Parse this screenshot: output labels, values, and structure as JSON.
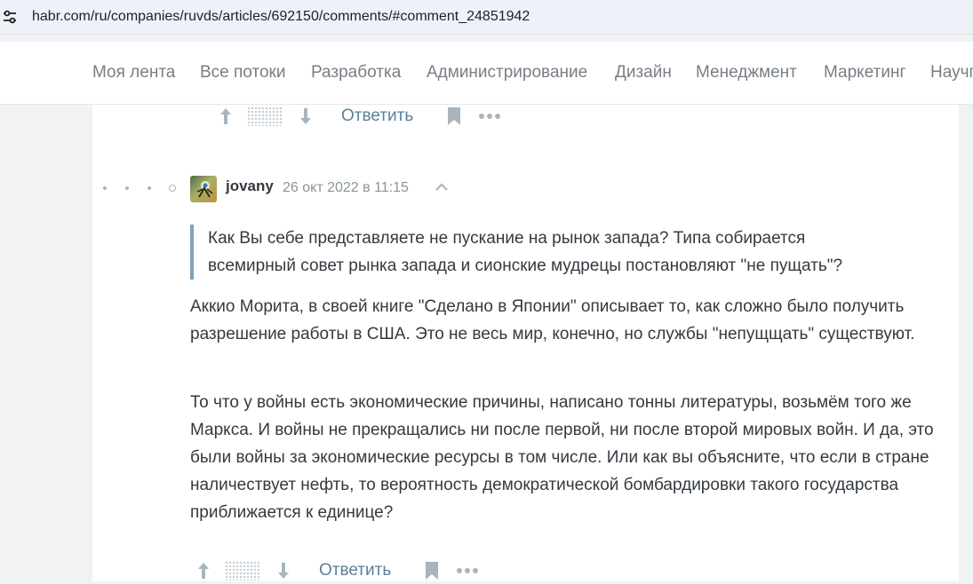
{
  "browser": {
    "url": "habr.com/ru/companies/ruvds/articles/692150/comments/#comment_24851942",
    "site_info_icon": "tune-icon"
  },
  "nav": {
    "items": [
      "Моя лента",
      "Все потоки",
      "Разработка",
      "Администрирование",
      "Дизайн",
      "Менеджмент",
      "Маркетинг",
      "Научпоп"
    ]
  },
  "prev_comment": {
    "reply_label": "Ответить"
  },
  "comment": {
    "author": "jovany",
    "timestamp": "26 окт 2022 в 11:15",
    "quote": "Как Вы себе представляете не пускание на рынок запада? Типа собирается всемирный совет рынка запада и сионские мудрецы постановляют \"не пущать\"?",
    "paragraphs": [
      "Аккио Морита, в своей книге \"Сделано в Японии\" описывает то, как сложно было получить разрешение работы в США. Это не весь мир, конечно, но службы \"непущщать\" существуют.",
      "То что у войны есть экономические причины, написано тонны литературы, возьмём того же Маркса. И войны не прекращались ни после первой, ни после второй мировых войн. И да, это были войны за экономические ресурсы в том числе. Или как вы объясните, что если в стране наличествует нефть, то вероятность демократической бомбардировки такого государства приближается к единице?"
    ],
    "reply_label": "Ответить"
  },
  "colors": {
    "link": "#5b7f99",
    "icon": "#aab4bb",
    "text": "#333a40",
    "quote_bar": "#7ea2ba"
  }
}
